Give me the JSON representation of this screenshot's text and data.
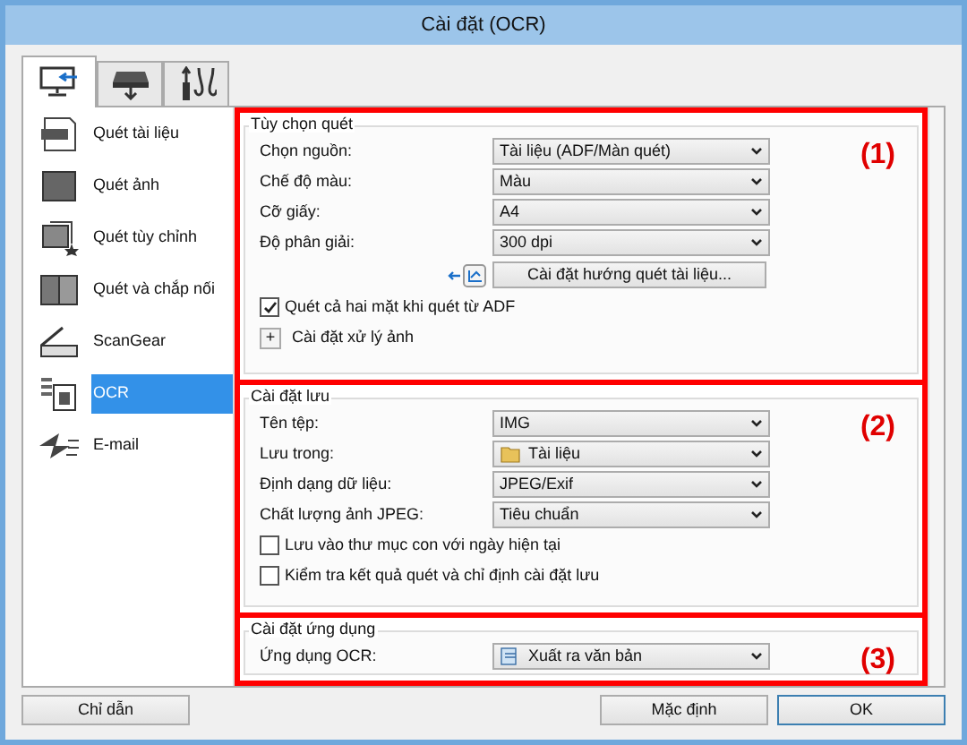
{
  "window": {
    "title": "Cài đặt (OCR)"
  },
  "tabs": [
    {
      "kind": "computer",
      "selected": true
    },
    {
      "kind": "scanner",
      "selected": false
    },
    {
      "kind": "tools",
      "selected": false
    }
  ],
  "sidebar": {
    "items": [
      {
        "kind": "document",
        "label": "Quét tài liệu",
        "selected": false
      },
      {
        "kind": "photo",
        "label": "Quét ảnh",
        "selected": false
      },
      {
        "kind": "custom",
        "label": "Quét tùy chỉnh",
        "selected": false
      },
      {
        "kind": "stitch",
        "label": "Quét và chắp nối",
        "selected": false
      },
      {
        "kind": "scangear",
        "label": "ScanGear",
        "selected": false
      },
      {
        "kind": "ocr",
        "label": "OCR",
        "selected": true
      },
      {
        "kind": "email",
        "label": "E-mail",
        "selected": false
      }
    ]
  },
  "sections": [
    {
      "title": "Tùy chọn quét",
      "marker": "(1)",
      "rows": [
        {
          "kind": "select",
          "label": "Chọn nguồn:",
          "value": "Tài liệu (ADF/Màn quét)"
        },
        {
          "kind": "select",
          "label": "Chế độ màu:",
          "value": "Màu"
        },
        {
          "kind": "select",
          "label": "Cỡ giấy:",
          "value": "A4"
        },
        {
          "kind": "select",
          "label": "Độ phân giải:",
          "value": "300 dpi"
        },
        {
          "kind": "button",
          "label": "Cài đặt hướng quét tài liệu..."
        },
        {
          "kind": "checkbox",
          "label": "Quét cả hai mặt khi quét từ ADF",
          "checked": true
        },
        {
          "kind": "expander",
          "label": "Cài đặt xử lý ảnh",
          "symbol": "+"
        }
      ]
    },
    {
      "title": "Cài đặt lưu",
      "marker": "(2)",
      "rows": [
        {
          "kind": "select",
          "label": "Tên tệp:",
          "value": "IMG"
        },
        {
          "kind": "folder",
          "label": "Lưu trong:",
          "value": "Tài liệu"
        },
        {
          "kind": "select",
          "label": "Định dạng dữ liệu:",
          "value": "JPEG/Exif"
        },
        {
          "kind": "select",
          "label": "Chất lượng ảnh JPEG:",
          "value": "Tiêu chuẩn"
        },
        {
          "kind": "checkbox",
          "label": "Lưu vào thư mục con với ngày hiện tại",
          "checked": false
        },
        {
          "kind": "checkbox",
          "label": "Kiểm tra kết quả quét và chỉ định cài đặt lưu",
          "checked": false
        }
      ]
    },
    {
      "title": "Cài đặt ứng dụng",
      "marker": "(3)",
      "rows": [
        {
          "kind": "app",
          "label": "Ứng dụng OCR:",
          "value": "Xuất ra văn bản"
        }
      ]
    }
  ],
  "buttons": {
    "help": "Chỉ dẫn",
    "defaults": "Mặc định",
    "ok": "OK"
  }
}
